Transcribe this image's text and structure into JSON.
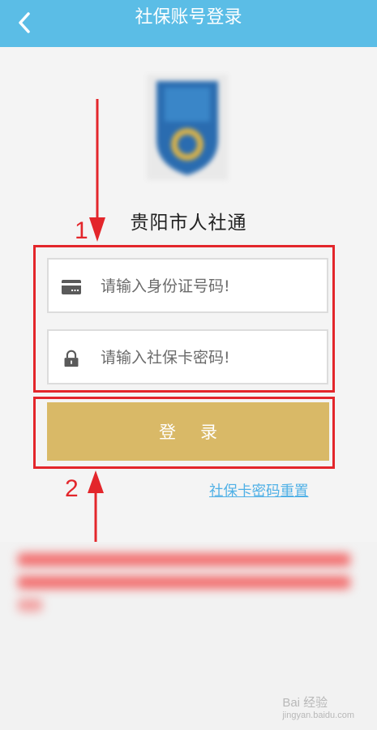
{
  "header": {
    "title": "社保账号登录",
    "back_icon": "chevron-left-icon"
  },
  "app": {
    "name": "贵阳市人社通"
  },
  "form": {
    "id_field": {
      "placeholder": "请输入身份证号码!",
      "icon": "id-card-icon"
    },
    "password_field": {
      "placeholder": "请输入社保卡密码!",
      "icon": "lock-icon"
    },
    "login_label": "登录",
    "reset_link": "社保卡密码重置"
  },
  "annotations": {
    "label_1": "1",
    "label_2": "2"
  },
  "watermark": {
    "text": "Bai 经验",
    "subtext": "jingyan.baidu.com"
  },
  "colors": {
    "header": "#5bbde6",
    "login_button": "#d9b967",
    "annotation": "#e3262b",
    "link": "#4fb0e6"
  }
}
